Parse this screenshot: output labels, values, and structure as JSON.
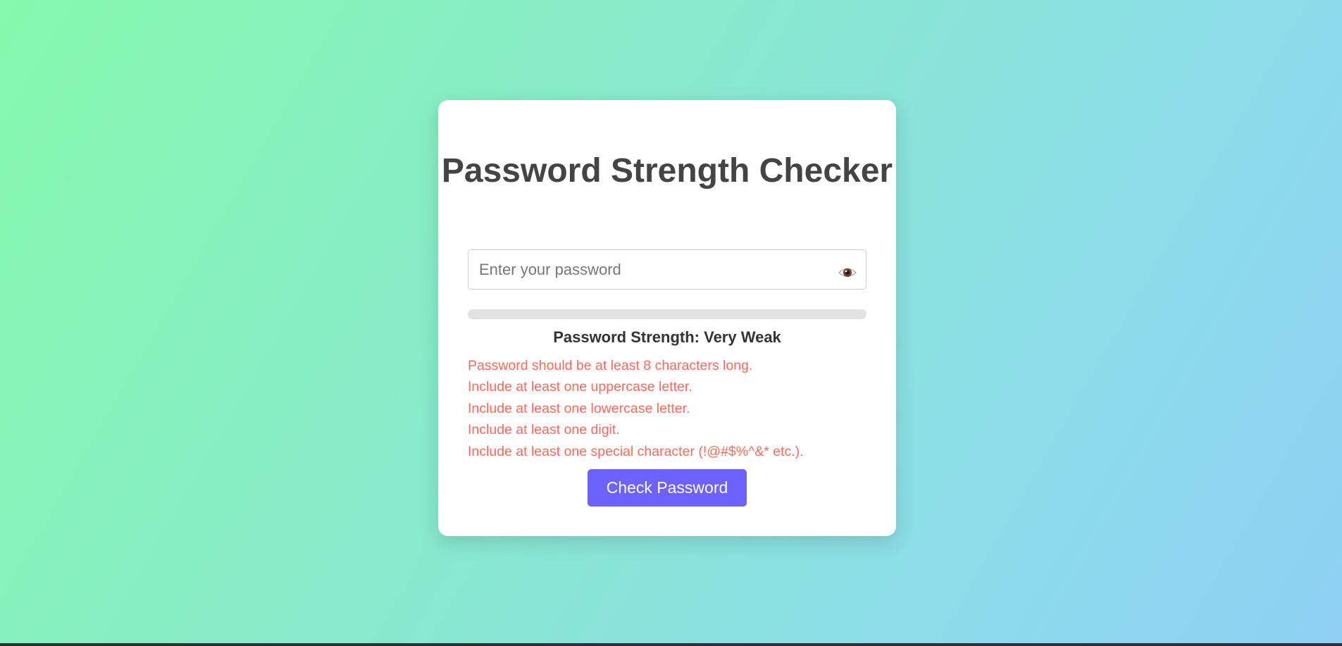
{
  "card": {
    "title": "Password Strength Checker",
    "password_input": {
      "value": "",
      "placeholder": "Enter your password"
    },
    "visibility_icon": "eye-icon",
    "strength_meter": {
      "level": 0
    },
    "strength_text": "Password Strength: Very Weak",
    "feedback": [
      "Password should be at least 8 characters long.",
      "Include at least one uppercase letter.",
      "Include at least one lowercase letter.",
      "Include at least one digit.",
      "Include at least one special character (!@#$%^&* etc.)."
    ],
    "check_button_label": "Check Password"
  },
  "colors": {
    "accent": "#6c63ff",
    "error_text": "#ff6a5a",
    "meter_track": "#e2e2e2",
    "background_start": "#86f9ad",
    "background_end": "#8fd0f4"
  }
}
